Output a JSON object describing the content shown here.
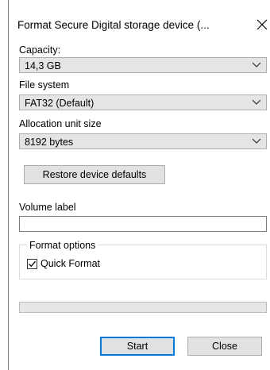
{
  "window": {
    "title": "Format Secure Digital storage device (...",
    "close_icon": "close-icon"
  },
  "capacity": {
    "label": "Capacity:",
    "value": "14,3 GB"
  },
  "file_system": {
    "label": "File system",
    "value": "FAT32 (Default)"
  },
  "allocation": {
    "label": "Allocation unit size",
    "value": "8192 bytes"
  },
  "restore_button": {
    "label": "Restore device defaults"
  },
  "volume_label": {
    "label": "Volume label",
    "value": ""
  },
  "format_options": {
    "title": "Format options",
    "quick_format": {
      "label": "Quick Format",
      "checked": true
    }
  },
  "progress": {
    "fraction": 0.0
  },
  "buttons": {
    "start": "Start",
    "close": "Close"
  },
  "colors": {
    "accent": "#0078d7",
    "button_bg": "#e1e1e1",
    "combo_bg": "#e5e5e5"
  }
}
